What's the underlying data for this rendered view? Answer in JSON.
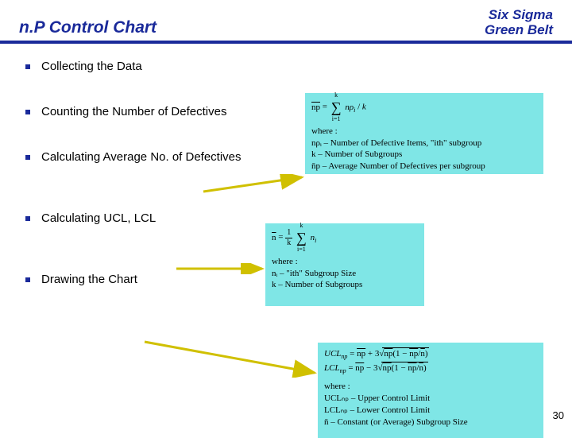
{
  "header": {
    "title": "n.P Control Chart",
    "brand_line1": "Six Sigma",
    "brand_line2": "Green Belt"
  },
  "bullets": [
    "Collecting the Data",
    "Counting the Number of Defectives",
    "Calculating Average No. of Defectives",
    "Calculating UCL, LCL",
    "Drawing the Chart"
  ],
  "equations": {
    "box1": {
      "main": "n̄p = (Σ nρᵢ) / k",
      "where": "where :",
      "l1": "nρᵢ – Number of Defective Items, \"ith\" subgroup",
      "l2": "k – Number of Subgroups",
      "l3": "n̄p – Average Number of Defectives per subgroup"
    },
    "box2": {
      "main": "n̄ = (1/k) Σ nᵢ",
      "where": "where :",
      "l1": "nᵢ – \"ith\" Subgroup Size",
      "l2": "k – Number of Subgroups"
    },
    "box3": {
      "ucl": "UCLₙₚ = n̄p + 3√(n̄p(1 − n̄p/n̄))",
      "lcl": "LCLₙₚ = n̄p − 3√(n̄p(1 − n̄p/n̄))",
      "where": "where :",
      "l1": "UCLₙₚ – Upper Control Limit",
      "l2": "LCLₙₚ – Lower Control Limit",
      "l3": "n̄ – Constant (or Average) Subgroup Size"
    }
  },
  "page_number": "30"
}
